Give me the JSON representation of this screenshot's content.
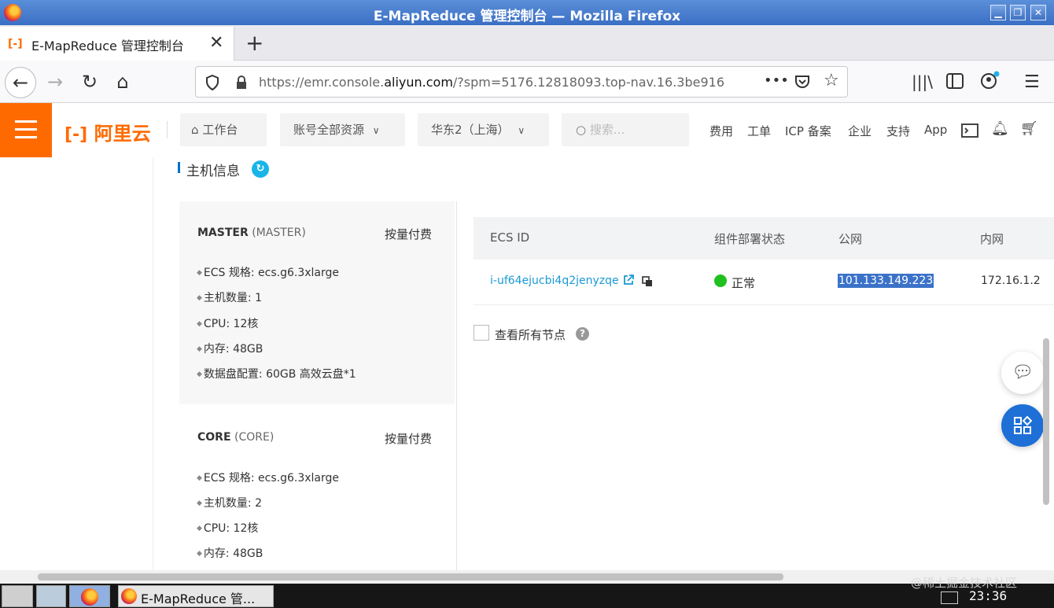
{
  "window": {
    "title": "E-MapReduce 管理控制台 — Mozilla Firefox"
  },
  "browser": {
    "tab_title": "E-MapReduce 管理控制台",
    "url_prefix": "https://emr.console.",
    "url_domain": "aliyun.com",
    "url_suffix": "/?spm=5176.12818093.top-nav.16.3be916",
    "more_dots": "•••"
  },
  "aliyun_nav": {
    "logo_text": "阿里云",
    "workbench": "工作台",
    "resources": "账号全部资源",
    "region": "华东2（上海）",
    "search_placeholder": "搜索...",
    "links": [
      "费用",
      "工单",
      "ICP 备案",
      "企业",
      "支持",
      "App"
    ]
  },
  "section": {
    "title": "主机信息"
  },
  "groups": [
    {
      "name": "MASTER",
      "role": "(MASTER)",
      "billing": "按量付费",
      "specs": [
        "ECS 规格: ecs.g6.3xlarge",
        "主机数量: 1",
        "CPU: 12核",
        "内存: 48GB",
        "数据盘配置: 60GB 高效云盘*1"
      ]
    },
    {
      "name": "CORE",
      "role": "(CORE)",
      "billing": "按量付费",
      "specs": [
        "ECS 规格: ecs.g6.3xlarge",
        "主机数量: 2",
        "CPU: 12核",
        "内存: 48GB"
      ]
    }
  ],
  "table": {
    "headers": [
      "ECS ID",
      "组件部署状态",
      "公网",
      "内网"
    ],
    "rows": [
      {
        "ecs_id": "i-uf64ejucbi4q2jenyzqe",
        "status": "正常",
        "public_ip": "101.133.149.223",
        "private_ip": "172.16.1.2"
      }
    ],
    "show_all_nodes": "查看所有节点"
  },
  "taskbar": {
    "task_title": "E-MapReduce 管...",
    "clock": "23:36"
  },
  "watermark": "@稀土掘金技术社区",
  "colors": {
    "aliyun_orange": "#ff6a00",
    "link_blue": "#1a9ad6",
    "status_green": "#1fc01f",
    "selection_blue": "#3b72c9"
  }
}
